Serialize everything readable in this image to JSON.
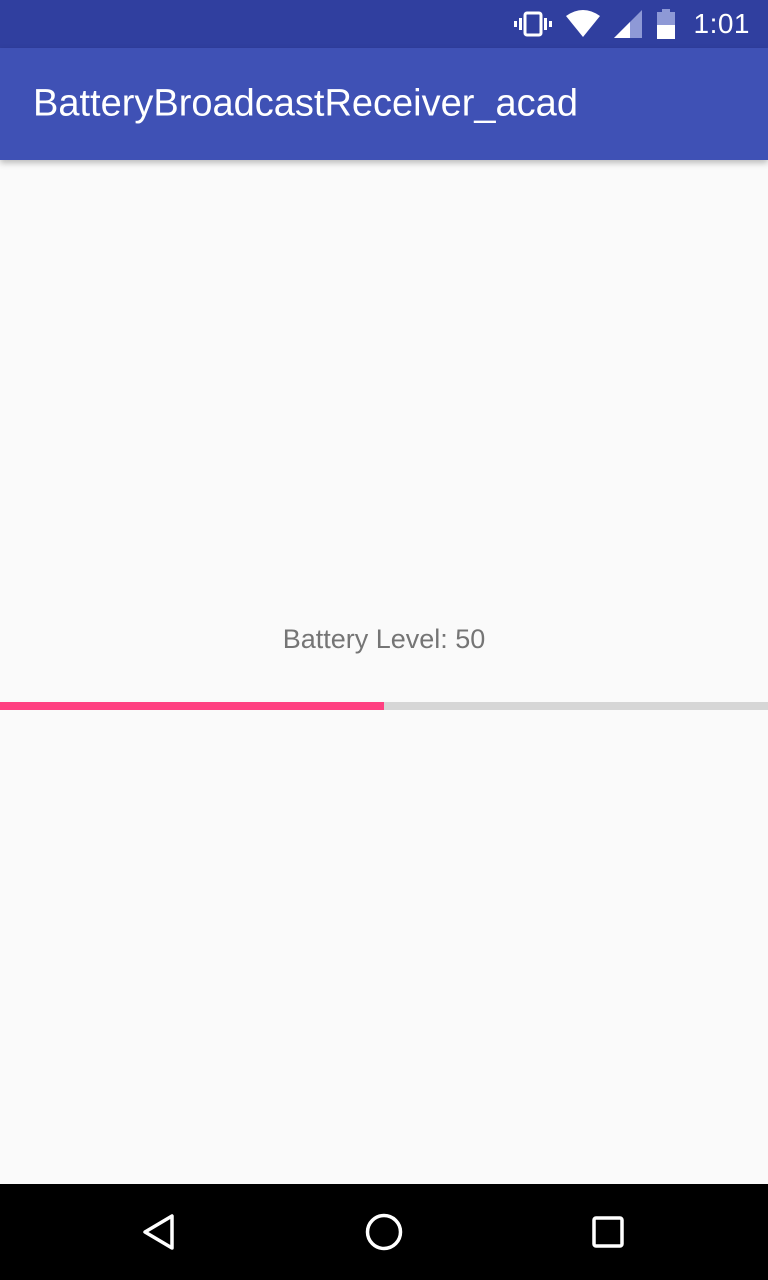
{
  "status_bar": {
    "time": "1:01",
    "icons": [
      "vibrate-icon",
      "wifi-icon",
      "cell-signal-icon",
      "battery-icon"
    ],
    "background": "#303f9f"
  },
  "app_bar": {
    "title": "BatteryBroadcastReceiver_acad",
    "background": "#3f51b5"
  },
  "main": {
    "battery_label": "Battery Level: 50",
    "battery_level": 50,
    "progress_max": 100,
    "progress_color": "#ff4081",
    "track_color": "#d6d6d6"
  },
  "nav_bar": {
    "buttons": [
      "back-icon",
      "home-icon",
      "recents-icon"
    ]
  }
}
